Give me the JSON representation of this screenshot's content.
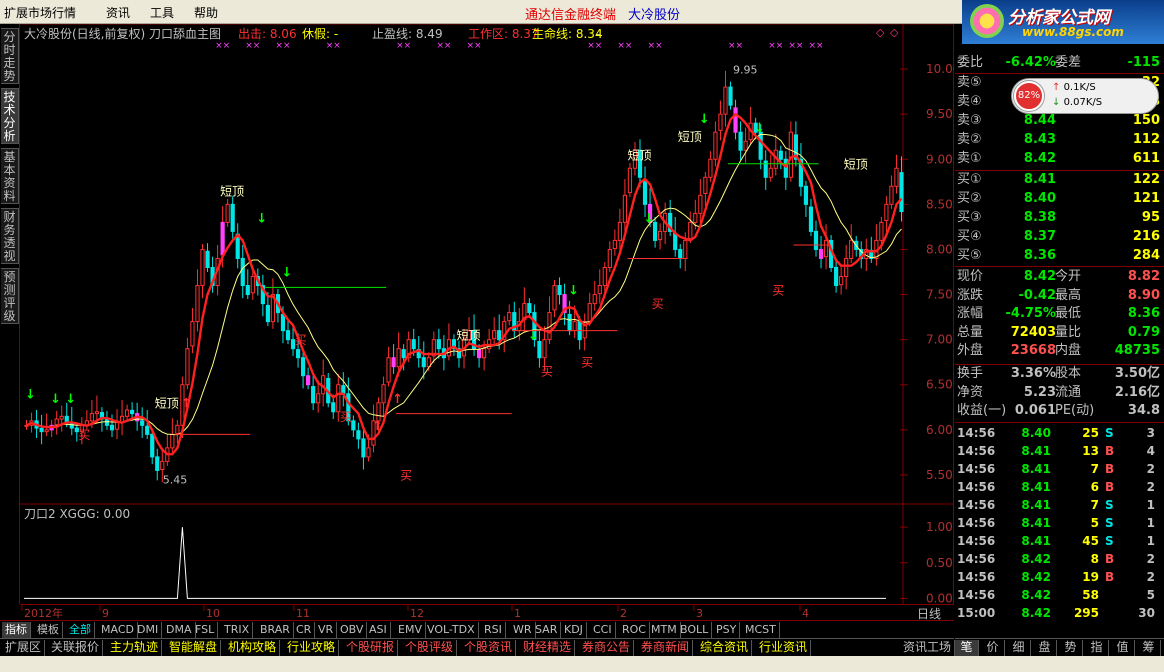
{
  "menu": {
    "items": [
      "扩展市场行情",
      "资讯",
      "工具",
      "帮助"
    ],
    "app_title": "通达信金融终端",
    "stock_title": "大冷股份"
  },
  "brand": {
    "name": "分析家公式网",
    "url": "www.88gs.com"
  },
  "vtabs": [
    "分时走势",
    "技术分析",
    "基本资料",
    "财务透视",
    "预测评级"
  ],
  "chart_header": {
    "title": "大冷股份(日线,前复权) 刀口舔血主图",
    "items": [
      {
        "label": "出击: 8.06",
        "color": "#ff3030"
      },
      {
        "label": "休假: -",
        "color": "#ffff00"
      },
      {
        "label": "止盈线: 8.49",
        "color": "#c0c0c0"
      },
      {
        "label": "工作区: 8.37",
        "color": "#ff3030"
      },
      {
        "label": "生命线: 8.34",
        "color": "#ffff00"
      },
      {
        "label": "-",
        "color": "#c0c0c0"
      }
    ]
  },
  "sub_header": {
    "title": "刀口2 XGGG: 0.00"
  },
  "chart_data": [
    {
      "type": "candlestick",
      "title": "大冷股份(日线,前复权) 刀口舔血主图",
      "y_ticks": [
        5.5,
        6.0,
        6.5,
        7.0,
        7.5,
        8.0,
        8.5,
        9.0,
        9.5,
        10.0
      ],
      "ylim": [
        5.2,
        10.3
      ],
      "annotations": {
        "high_label": "9.95",
        "low_label": "5.45",
        "short_top": "短顶",
        "buy": "买"
      },
      "x_labels": [
        "2012年",
        "9",
        "10",
        "11",
        "12",
        "1",
        "2",
        "3",
        "4"
      ],
      "closes": [
        6.05,
        6.1,
        6.02,
        5.98,
        6.0,
        6.05,
        6.12,
        6.15,
        6.08,
        6.02,
        5.98,
        6.05,
        6.1,
        6.18,
        6.2,
        6.12,
        6.05,
        6.0,
        6.08,
        6.15,
        6.22,
        6.18,
        6.1,
        6.05,
        5.95,
        5.7,
        5.55,
        5.65,
        5.8,
        5.95,
        6.05,
        6.5,
        6.9,
        7.2,
        7.6,
        8.0,
        7.8,
        7.6,
        7.9,
        8.3,
        8.5,
        8.2,
        7.9,
        7.6,
        7.5,
        7.7,
        7.6,
        7.4,
        7.2,
        7.5,
        7.3,
        7.1,
        7.0,
        6.9,
        6.8,
        6.6,
        6.5,
        6.3,
        6.4,
        6.6,
        6.3,
        6.2,
        6.5,
        6.4,
        6.1,
        6.0,
        5.9,
        5.7,
        5.8,
        6.1,
        6.3,
        6.5,
        6.8,
        6.7,
        6.9,
        6.8,
        7.0,
        6.9,
        6.8,
        6.7,
        6.8,
        7.0,
        6.9,
        6.8,
        7.0,
        6.9,
        6.8,
        7.0,
        7.1,
        6.9,
        6.8,
        6.9,
        7.0,
        7.1,
        7.0,
        7.2,
        7.3,
        7.1,
        7.2,
        7.4,
        7.3,
        7.0,
        6.8,
        7.0,
        7.3,
        7.6,
        7.5,
        7.3,
        7.1,
        7.2,
        7.0,
        7.2,
        7.4,
        7.5,
        7.6,
        7.8,
        8.0,
        8.1,
        8.3,
        8.6,
        8.9,
        9.1,
        8.8,
        8.5,
        8.3,
        8.1,
        8.2,
        8.4,
        8.2,
        8.0,
        7.9,
        8.1,
        8.3,
        8.4,
        8.6,
        8.8,
        9.0,
        9.3,
        9.5,
        9.8,
        9.6,
        9.3,
        9.1,
        9.2,
        9.4,
        9.3,
        9.0,
        8.8,
        8.9,
        9.1,
        9.0,
        8.8,
        9.3,
        9.0,
        8.7,
        8.5,
        8.2,
        8.0,
        7.9,
        8.1,
        7.8,
        7.6,
        7.7,
        7.9,
        8.1,
        8.0,
        7.9,
        8.0,
        7.9,
        8.1,
        8.3,
        8.5,
        8.7,
        8.9,
        8.42
      ]
    },
    {
      "type": "line",
      "title": "刀口2 XGGG: 0.00",
      "y_ticks": [
        0.0,
        0.5,
        1.0
      ],
      "ylim": [
        -0.05,
        1.1
      ],
      "spike_index": 31,
      "values_note": "zero except spike"
    }
  ],
  "period_label": "日线",
  "indicator_tabs": [
    "指标",
    "模板",
    "全部",
    "MACD",
    "DMI",
    "DMA",
    "FSL",
    "TRIX",
    "BRAR",
    "CR",
    "VR",
    "OBV",
    "ASI",
    "EMV",
    "VOL-TDX",
    "RSI",
    "WR",
    "SAR",
    "KDJ",
    "CCI",
    "ROC",
    "MTM",
    "BOLL",
    "PSY",
    "MCST"
  ],
  "bottom_tabs": [
    "扩展区",
    "关联报价",
    "主力轨迹",
    "智能解盘",
    "机构攻略",
    "行业攻略",
    "个股研报",
    "个股评级",
    "个股资讯",
    "财经精选",
    "券商公告",
    "券商新闻",
    "综合资讯",
    "行业资讯"
  ],
  "bottom_right_tab": "资讯工场",
  "right_tabs": [
    "笔",
    "价",
    "细",
    "盘",
    "势",
    "指",
    "值",
    "筹"
  ],
  "quote": {
    "weibi_label": "委比",
    "weibi": "-6.42%",
    "weicha_label": "委差",
    "weicha": "-115",
    "gauge_pct": "82%",
    "gauge_up": "0.1K/S",
    "gauge_down": "0.07K/S",
    "sell": [
      {
        "label": "卖⑤",
        "price": "",
        "vol": "32"
      },
      {
        "label": "卖④",
        "price": "",
        "vol": "48"
      },
      {
        "label": "卖③",
        "price": "8.44",
        "vol": "150"
      },
      {
        "label": "卖②",
        "price": "8.43",
        "vol": "112"
      },
      {
        "label": "卖①",
        "price": "8.42",
        "vol": "611"
      }
    ],
    "buy": [
      {
        "label": "买①",
        "price": "8.41",
        "vol": "122"
      },
      {
        "label": "买②",
        "price": "8.40",
        "vol": "121"
      },
      {
        "label": "买③",
        "price": "8.38",
        "vol": "95"
      },
      {
        "label": "买④",
        "price": "8.37",
        "vol": "216"
      },
      {
        "label": "买⑤",
        "price": "8.36",
        "vol": "284"
      }
    ],
    "stats": [
      {
        "l1": "现价",
        "v1": "8.42",
        "c1": "#00e600",
        "l2": "今开",
        "v2": "8.82",
        "c2": "#ff5050"
      },
      {
        "l1": "涨跌",
        "v1": "-0.42",
        "c1": "#00e600",
        "l2": "最高",
        "v2": "8.90",
        "c2": "#ff5050"
      },
      {
        "l1": "涨幅",
        "v1": "-4.75%",
        "c1": "#00e600",
        "l2": "最低",
        "v2": "8.36",
        "c2": "#00e600"
      },
      {
        "l1": "总量",
        "v1": "72403",
        "c1": "#ffff00",
        "l2": "量比",
        "v2": "0.79",
        "c2": "#00e600"
      },
      {
        "l1": "外盘",
        "v1": "23668",
        "c1": "#ff5050",
        "l2": "内盘",
        "v2": "48735",
        "c2": "#00e600"
      }
    ],
    "fin": [
      {
        "l1": "换手",
        "v1": "3.36%",
        "l2": "股本",
        "v2": "3.50亿"
      },
      {
        "l1": "净资",
        "v1": "5.23",
        "l2": "流通",
        "v2": "2.16亿"
      },
      {
        "l1": "收益(一)",
        "v1": "0.061",
        "l2": "PE(动)",
        "v2": "34.8"
      }
    ],
    "ticks": [
      {
        "t": "14:56",
        "p": "8.40",
        "v": "25",
        "s": "S",
        "n": "3"
      },
      {
        "t": "14:56",
        "p": "8.41",
        "v": "13",
        "s": "B",
        "n": "4"
      },
      {
        "t": "14:56",
        "p": "8.41",
        "v": "7",
        "s": "B",
        "n": "2"
      },
      {
        "t": "14:56",
        "p": "8.41",
        "v": "6",
        "s": "B",
        "n": "2"
      },
      {
        "t": "14:56",
        "p": "8.41",
        "v": "7",
        "s": "S",
        "n": "1"
      },
      {
        "t": "14:56",
        "p": "8.41",
        "v": "5",
        "s": "S",
        "n": "1"
      },
      {
        "t": "14:56",
        "p": "8.41",
        "v": "45",
        "s": "S",
        "n": "1"
      },
      {
        "t": "14:56",
        "p": "8.42",
        "v": "8",
        "s": "B",
        "n": "2"
      },
      {
        "t": "14:56",
        "p": "8.42",
        "v": "19",
        "s": "B",
        "n": "2"
      },
      {
        "t": "14:56",
        "p": "8.42",
        "v": "58",
        "s": "",
        "n": "5"
      },
      {
        "t": "15:00",
        "p": "8.42",
        "v": "295",
        "s": "",
        "n": "30"
      }
    ]
  },
  "colors": {
    "up": "#ff3030",
    "down": "#00e5e5",
    "bg": "#000000",
    "axis": "#800000",
    "ma": "#ffff80",
    "life": "#ff2020"
  }
}
